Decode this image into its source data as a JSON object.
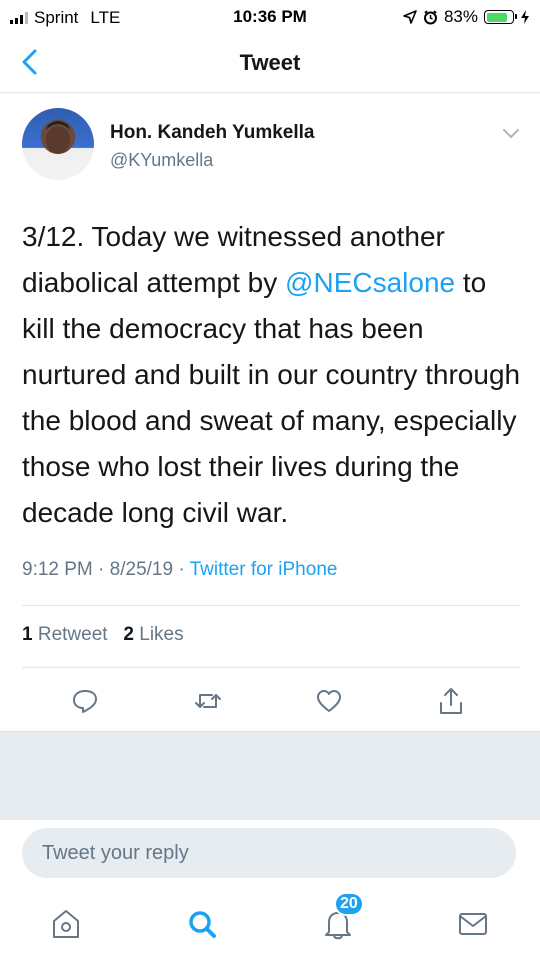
{
  "status_bar": {
    "carrier": "Sprint",
    "network": "LTE",
    "time": "10:36 PM",
    "battery_percent": "83%",
    "battery_level": 0.83,
    "icons": [
      "signal-icon",
      "location-icon",
      "alarm-icon",
      "battery-icon",
      "charging-icon"
    ]
  },
  "nav": {
    "title": "Tweet",
    "back_icon": "chevron-left-icon"
  },
  "tweet": {
    "author_name": "Hon. Kandeh Yumkella",
    "author_handle": "@KYumkella",
    "text_before_mention": "3/12. Today we witnessed another diabolical attempt by ",
    "mention": "@NECsalone",
    "text_after_mention": " to kill the democracy that has been nurtured and built in our country through the blood and sweat of many, especially those who lost their lives during the decade long civil war.",
    "time": "9:12 PM",
    "date": "8/25/19",
    "separator": " · ",
    "source": "Twitter for iPhone",
    "retweet_count": "1",
    "retweet_label": "Retweet",
    "like_count": "2",
    "like_label": "Likes"
  },
  "actions": [
    "reply-icon",
    "retweet-icon",
    "like-icon",
    "share-icon"
  ],
  "reply": {
    "placeholder": "Tweet your reply"
  },
  "tabbar": {
    "tabs": [
      "home-icon",
      "search-icon",
      "notifications-icon",
      "messages-icon"
    ],
    "notifications_badge": "20"
  },
  "colors": {
    "accent": "#1da1f2",
    "secondary_text": "#657786",
    "divider": "#e1e8ed",
    "battery": "#4cd964"
  }
}
